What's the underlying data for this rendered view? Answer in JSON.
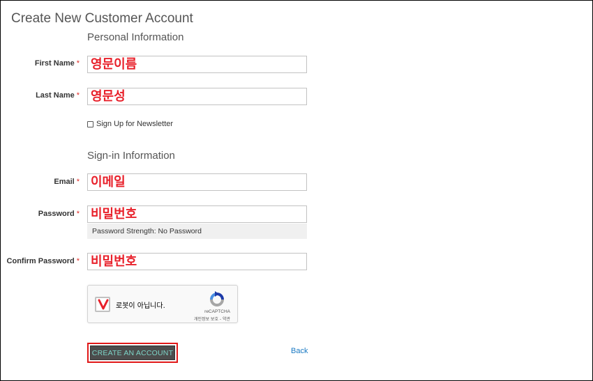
{
  "page": {
    "title": "Create New Customer Account"
  },
  "personal": {
    "section_title": "Personal Information",
    "first_name": {
      "label": "First Name",
      "required_mark": "*",
      "value": "영문이름"
    },
    "last_name": {
      "label": "Last Name",
      "required_mark": "*",
      "value": "영문성"
    },
    "newsletter": {
      "label": "Sign Up for Newsletter",
      "checked": false
    }
  },
  "signin": {
    "section_title": "Sign-in Information",
    "email": {
      "label": "Email",
      "required_mark": "*",
      "value": "이메일"
    },
    "password": {
      "label": "Password",
      "required_mark": "*",
      "value": "비밀번호",
      "strength_text": "Password Strength: No Password"
    },
    "confirm_password": {
      "label": "Confirm Password",
      "required_mark": "*",
      "value": "비밀번호"
    }
  },
  "recaptcha": {
    "label": "로봇이 아닙니다.",
    "brand": "reCAPTCHA",
    "links": "개인정보 보호 - 약관"
  },
  "actions": {
    "create_label": "CREATE AN ACCOUNT",
    "back_label": "Back"
  },
  "colors": {
    "annotation_red": "#e8202a",
    "button_bg": "#4c4c4c",
    "button_text": "#7dd5c8",
    "link": "#1979c3",
    "required": "#e02b27"
  }
}
